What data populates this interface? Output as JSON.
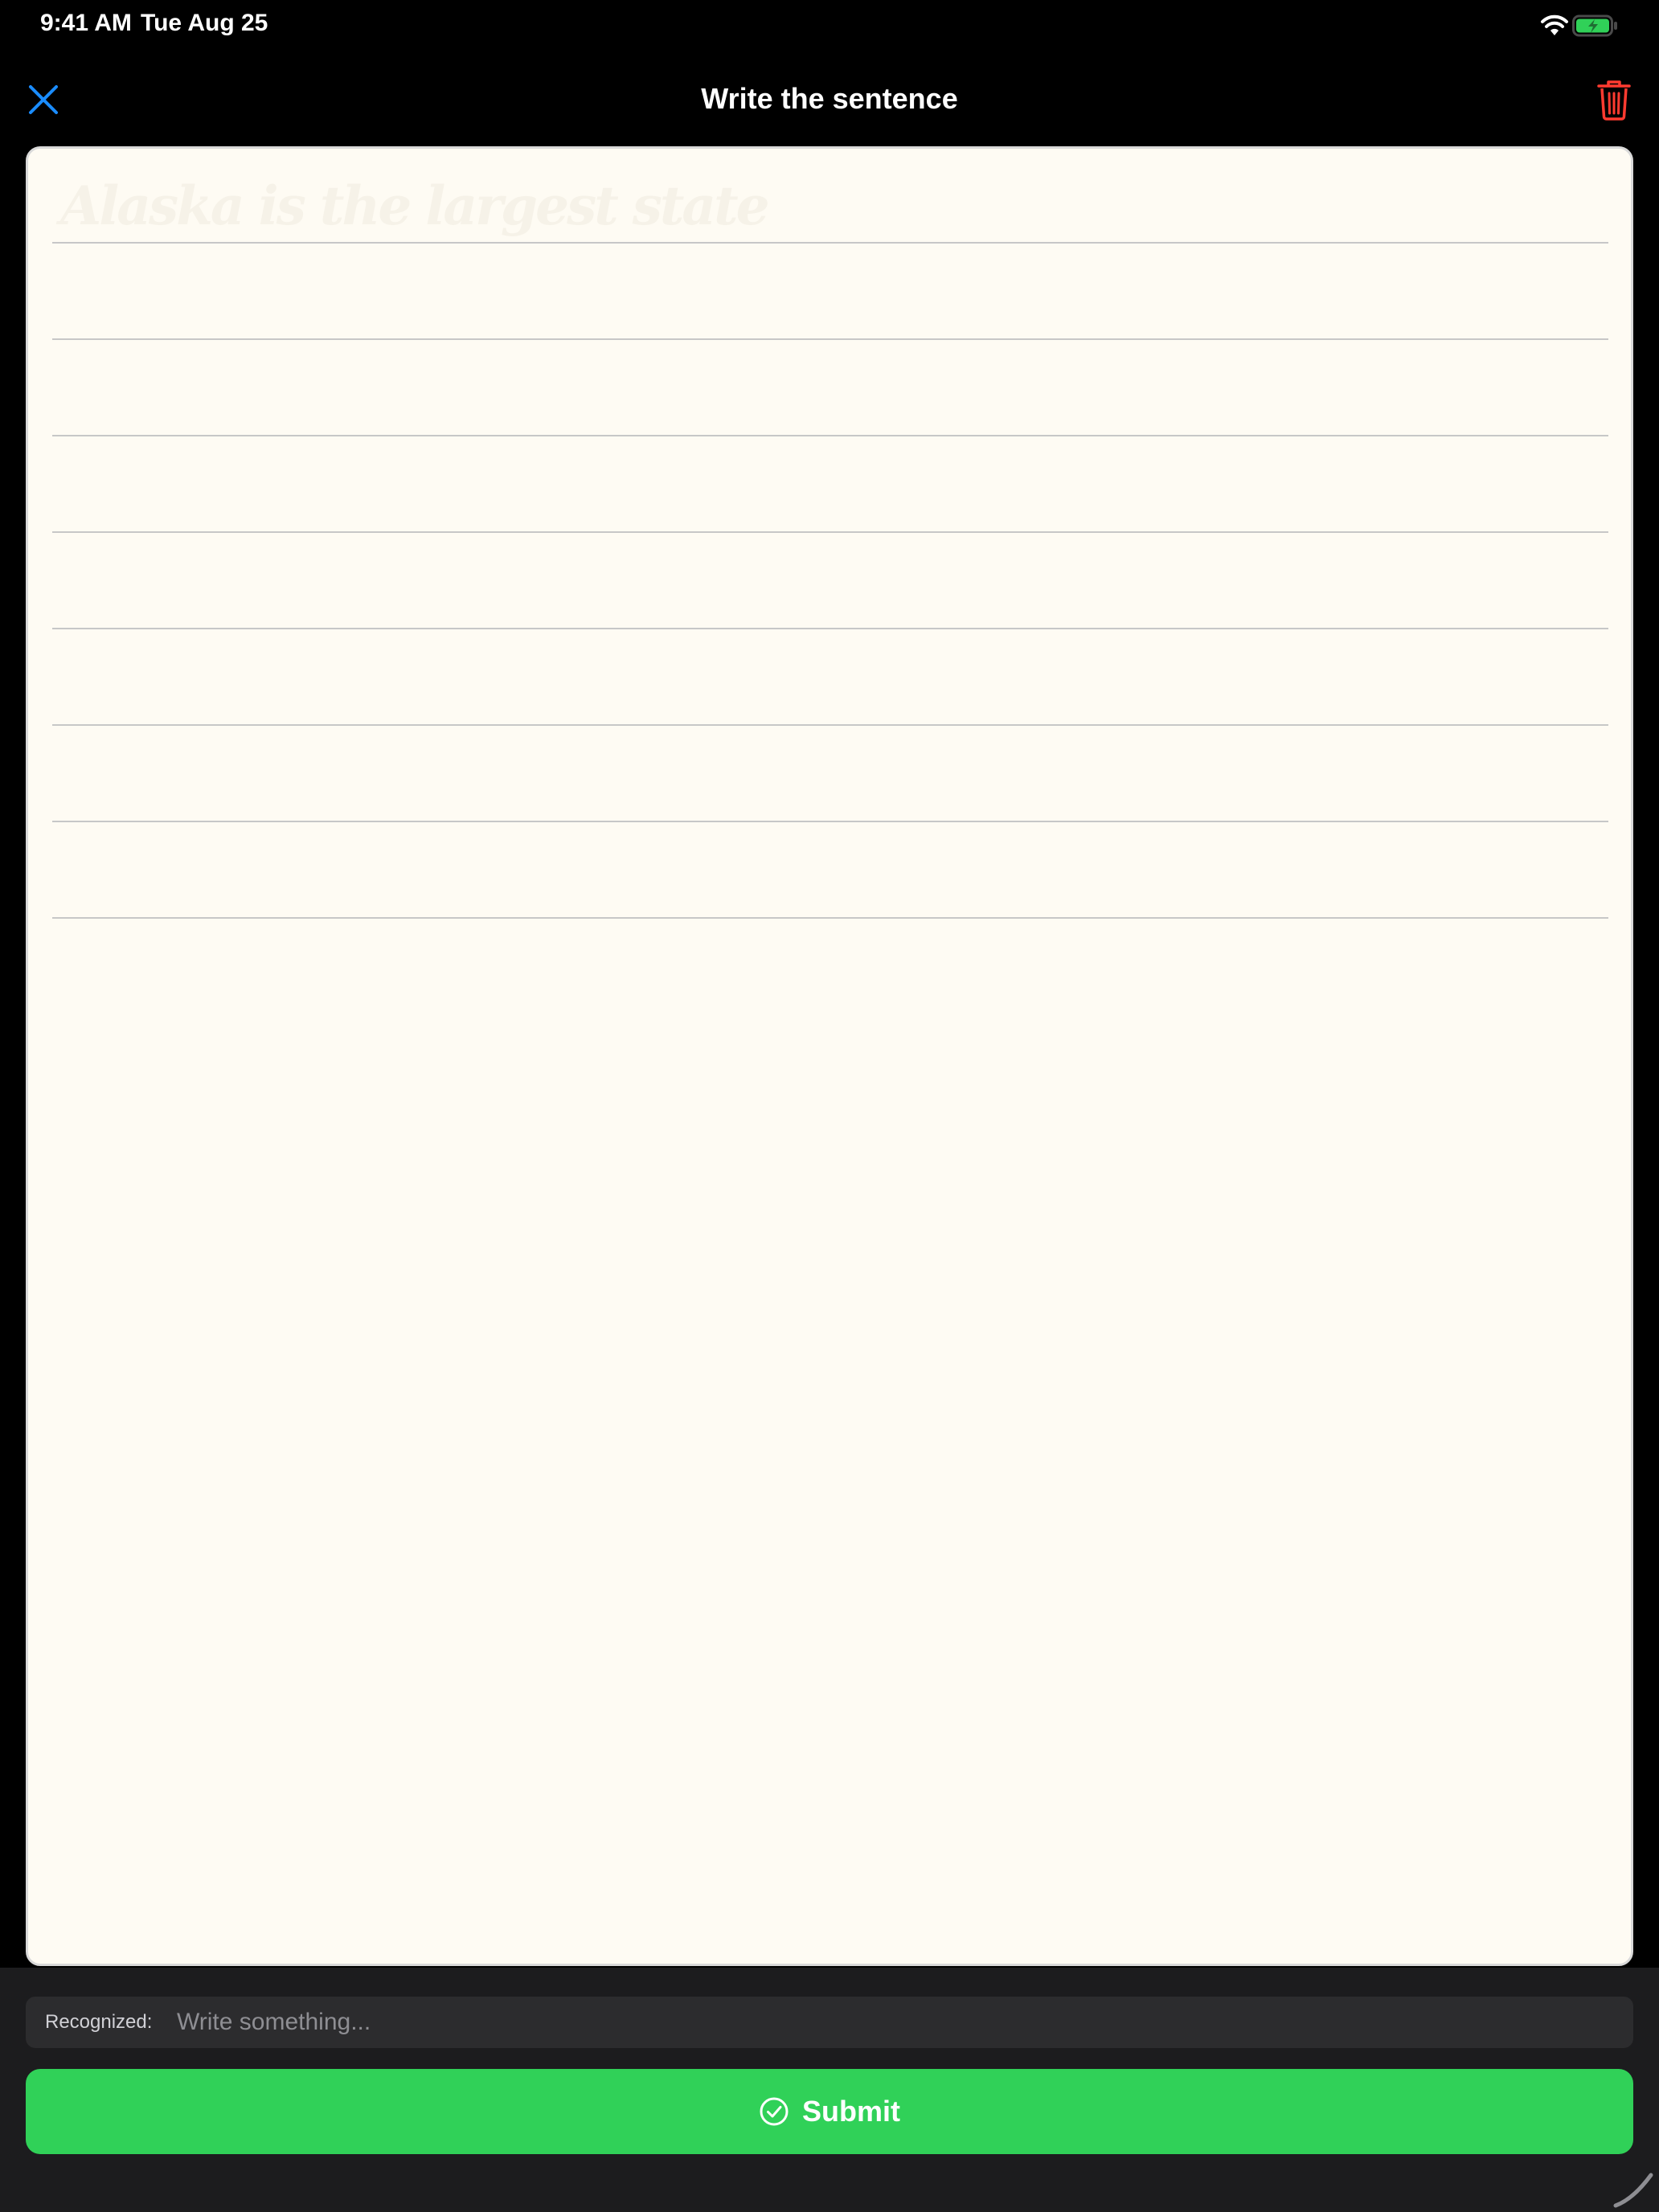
{
  "status_bar": {
    "time": "9:41 AM",
    "date": "Tue Aug 25",
    "icons": [
      "wifi-icon",
      "battery-charging-icon"
    ]
  },
  "nav": {
    "title": "Write the sentence",
    "close_icon": "close-icon",
    "trash_icon": "trash-icon"
  },
  "canvas": {
    "guide_sentence": "Alaska is the largest state",
    "ruled_line_count": 8
  },
  "recognized": {
    "label": "Recognized:",
    "placeholder": "Write something...",
    "value": ""
  },
  "submit": {
    "label": "Submit",
    "icon": "checkmark-circle-icon"
  },
  "colors": {
    "accent_blue": "#1a8cff",
    "destructive_red": "#ff3b30",
    "submit_green": "#30d158",
    "paper": "#fefbf3"
  }
}
